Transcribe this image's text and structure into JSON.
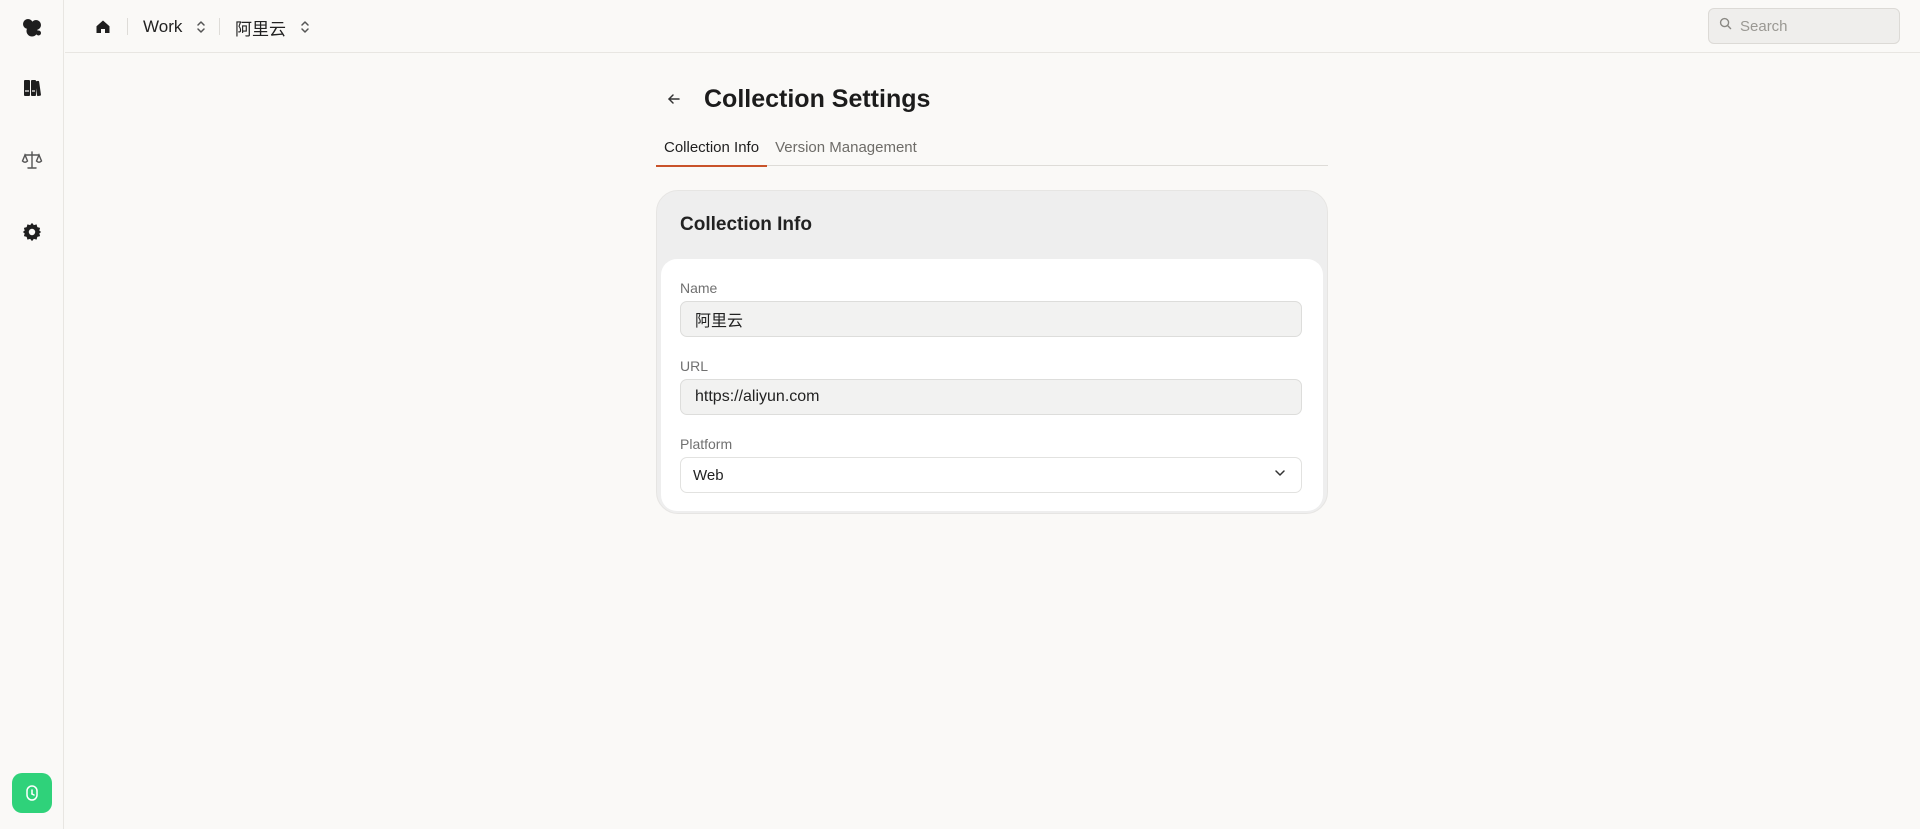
{
  "breadcrumb": {
    "workspace": "Work",
    "collection": "阿里云"
  },
  "search": {
    "placeholder": "Search"
  },
  "page": {
    "title": "Collection Settings"
  },
  "tabs": [
    {
      "label": "Collection Info",
      "active": true
    },
    {
      "label": "Version Management",
      "active": false
    }
  ],
  "card": {
    "title": "Collection Info",
    "fields": {
      "name_label": "Name",
      "name_value": "阿里云",
      "url_label": "URL",
      "url_value": "https://aliyun.com",
      "platform_label": "Platform",
      "platform_value": "Web"
    }
  },
  "colors": {
    "accent": "#c9532a",
    "status_green": "#2fd27a"
  },
  "icons": {
    "rail": [
      "app-logo-icon",
      "books-icon",
      "scale-icon",
      "gear-icon",
      "timer-icon"
    ],
    "topbar": [
      "home-icon",
      "chevron-up-down-icon",
      "search-icon"
    ]
  }
}
